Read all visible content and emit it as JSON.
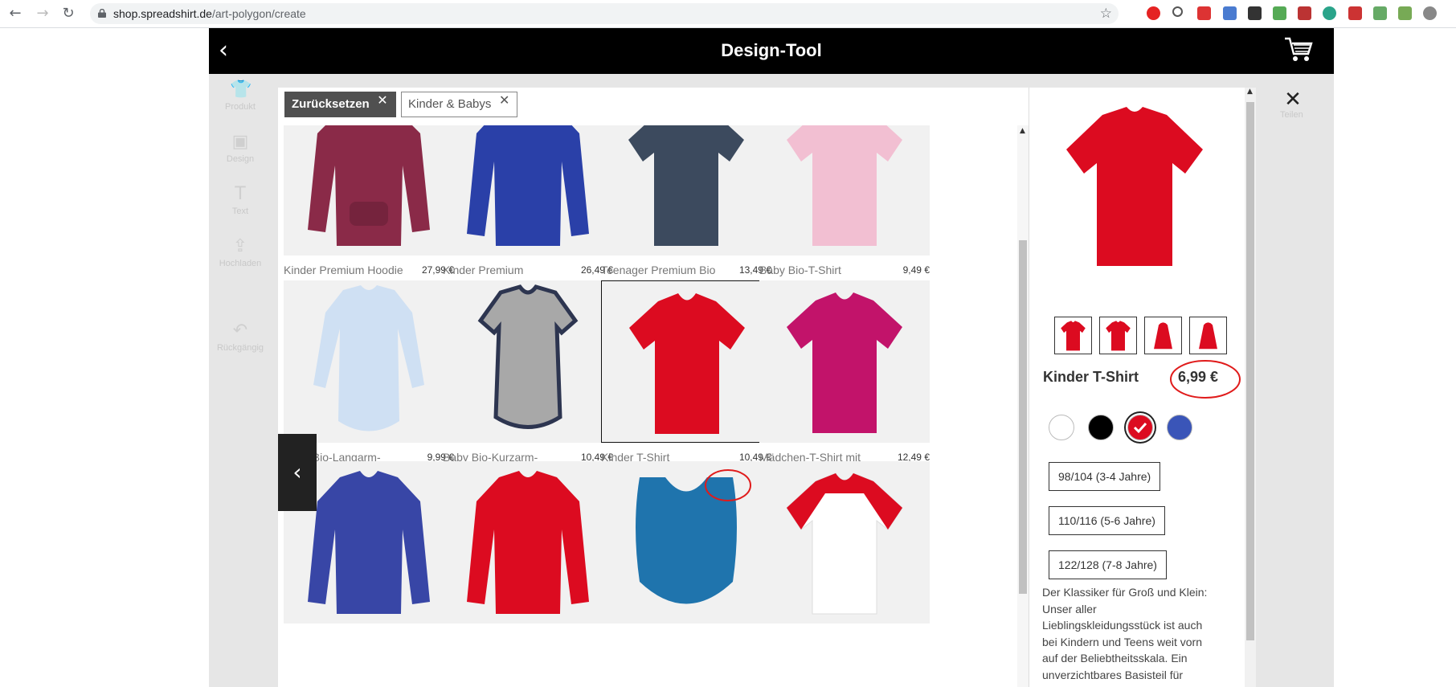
{
  "browser": {
    "url_host": "shop.spreadshirt.de",
    "url_path": "/art-polygon/create"
  },
  "app": {
    "title": "Design-Tool"
  },
  "sidebar": {
    "items": [
      {
        "label": "Produkt",
        "icon": "shirt-icon"
      },
      {
        "label": "Design",
        "icon": "image-icon"
      },
      {
        "label": "Text",
        "icon": "text-icon"
      },
      {
        "label": "Hochladen",
        "icon": "upload-icon"
      },
      {
        "label": "Rückgängig",
        "icon": "undo-icon"
      }
    ]
  },
  "share": {
    "label": "Teilen"
  },
  "filters": {
    "reset_label": "Zurücksetzen",
    "active_filter": "Kinder & Babys"
  },
  "products": [
    {
      "name": "Kinder Premium Hoodie",
      "price": "27,99 €",
      "color": "#8a2a48",
      "shape": "hoodie"
    },
    {
      "name": "Kinder Premium Pullover",
      "price": "26,49 €",
      "color": "#2a40a8",
      "shape": "long"
    },
    {
      "name": "Teenager Premium Bio T-Shirt",
      "price": "13,49 €",
      "color": "#3c4a5e",
      "shape": "tee"
    },
    {
      "name": "Baby Bio-T-Shirt",
      "price": "9,49 €",
      "color": "#f2bfd2",
      "shape": "tee"
    },
    {
      "name": "Baby Bio-Langarm-Body",
      "price": "9,99 €",
      "color": "#cfe0f3",
      "shape": "body-long"
    },
    {
      "name": "Baby Bio-Kurzarm-Kontrastbody",
      "price": "10,49 €",
      "color": "#a8a8a8",
      "shape": "body-short"
    },
    {
      "name": "Kinder T-Shirt",
      "price": "10,49 €",
      "color": "#dc0b20",
      "shape": "tee",
      "selected": true
    },
    {
      "name": "Mädchen-T-Shirt mit Raffungen",
      "price": "12,49 €",
      "color": "#c2136a",
      "shape": "tee"
    },
    {
      "name": "",
      "price": "",
      "color": "#3846a6",
      "shape": "long"
    },
    {
      "name": "",
      "price": "",
      "color": "#dc0b20",
      "shape": "long"
    },
    {
      "name": "",
      "price": "",
      "color": "#1f74ad",
      "shape": "bib"
    },
    {
      "name": "",
      "price": "",
      "color": "#dc0b20",
      "shape": "raglan"
    }
  ],
  "detail": {
    "product_name": "Kinder T-Shirt",
    "price": "6,99 €",
    "main_color": "#dc0b20",
    "colors": [
      {
        "hex": "#ffffff",
        "selected": false
      },
      {
        "hex": "#000000",
        "selected": false
      },
      {
        "hex": "#dc0b20",
        "selected": true
      },
      {
        "hex": "#3a55b8",
        "selected": false
      }
    ],
    "sizes": [
      "98/104 (3-4 Jahre)",
      "110/116 (5-6 Jahre)",
      "122/128 (7-8 Jahre)"
    ],
    "description": "Der Klassiker für Groß und Klein: Unser aller Lieblingskleidungsstück ist auch bei Kindern und Teens weit vorn auf der Beliebtheitsskala. Ein unverzichtbares Basisteil für"
  }
}
